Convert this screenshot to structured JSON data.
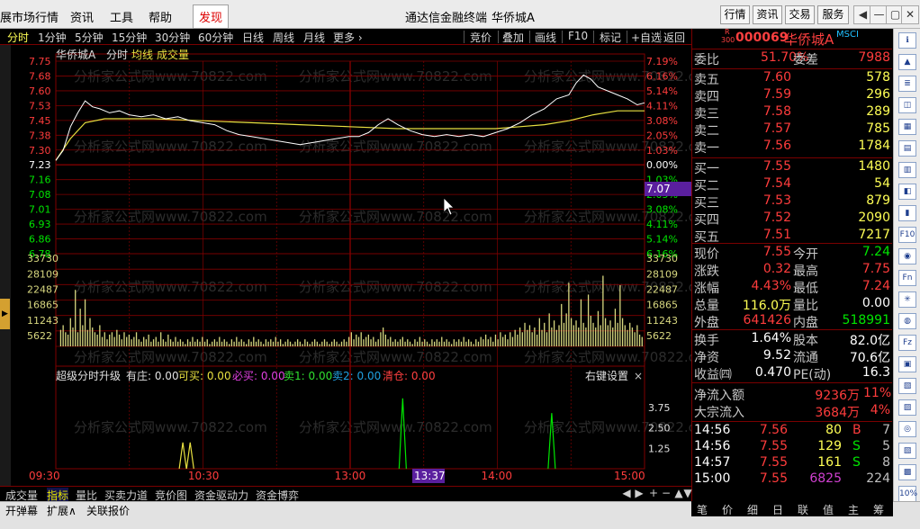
{
  "menu": {
    "items": [
      "展市场行情",
      "资讯",
      "工具",
      "帮助",
      "发现"
    ],
    "app_title": "通达信金融终端",
    "stock_title": "华侨城A",
    "right_buttons": [
      "行情",
      "资讯",
      "交易",
      "服务"
    ],
    "window_controls": [
      "◀",
      "—",
      "▢",
      "✕"
    ]
  },
  "period_bar": {
    "left": [
      "分时",
      "1分钟",
      "5分钟",
      "15分钟",
      "30分钟",
      "60分钟",
      "日线",
      "周线",
      "月线",
      "更多 ›"
    ],
    "right": [
      "竞价",
      "叠加",
      "画线",
      "F10",
      "标记",
      "+自选",
      "返回"
    ]
  },
  "chart_header": {
    "name": "华侨城A",
    "mode": "分时",
    "avg_label": "均线",
    "vol_label": "成交量"
  },
  "cursor_price_label": "7.07",
  "cursor_time_label": "13:37",
  "watermark": "分析家公式网www.70822.com",
  "indicator_header": {
    "title": "超级分时升级",
    "you_zhu": "有庄: 0.00",
    "ke_mai": "可买: 0.00",
    "bi_mai": "必买: 0.00",
    "mai1": "卖1: 0.00",
    "mai2": "卖2: 0.00",
    "qing_cang": "清仓: 0.00",
    "settings": "右键设置",
    "close": "×"
  },
  "indicator_ticks": [
    "3.75",
    "2.50",
    "1.25"
  ],
  "colors": {
    "up": "#ff3c3c",
    "down": "#00e600",
    "grid": "#800000",
    "price_line": "#ffffff",
    "avg_line": "#e8e040",
    "volume": "#d8d880"
  },
  "chart_data": {
    "type": "line",
    "x_labels": [
      "09:30",
      "10:30",
      "13:00",
      "14:00",
      "15:00"
    ],
    "price_ticks": [
      "7.75",
      "7.68",
      "7.60",
      "7.53",
      "7.45",
      "7.38",
      "7.30",
      "7.23",
      "7.16",
      "7.08",
      "7.01",
      "6.93",
      "6.86",
      "6.78"
    ],
    "pct_ticks": [
      "7.19%",
      "6.16%",
      "5.14%",
      "4.11%",
      "3.08%",
      "2.05%",
      "1.03%",
      "0.00%",
      "1.03%",
      "2.05%",
      "3.08%",
      "4.11%",
      "5.14%",
      "6.16%"
    ],
    "ylim": [
      6.78,
      7.75
    ],
    "prev_close": 7.24,
    "price_series": [
      [
        0,
        7.25
      ],
      [
        3,
        7.3
      ],
      [
        6,
        7.42
      ],
      [
        9,
        7.49
      ],
      [
        12,
        7.55
      ],
      [
        15,
        7.52
      ],
      [
        18,
        7.51
      ],
      [
        22,
        7.49
      ],
      [
        26,
        7.5
      ],
      [
        30,
        7.48
      ],
      [
        35,
        7.47
      ],
      [
        40,
        7.48
      ],
      [
        45,
        7.46
      ],
      [
        50,
        7.47
      ],
      [
        55,
        7.45
      ],
      [
        60,
        7.44
      ],
      [
        65,
        7.43
      ],
      [
        70,
        7.4
      ],
      [
        75,
        7.38
      ],
      [
        80,
        7.37
      ],
      [
        85,
        7.36
      ],
      [
        90,
        7.35
      ],
      [
        95,
        7.34
      ],
      [
        100,
        7.33
      ],
      [
        105,
        7.34
      ],
      [
        110,
        7.35
      ],
      [
        115,
        7.36
      ],
      [
        120,
        7.37
      ],
      [
        124,
        7.37
      ],
      [
        128,
        7.39
      ],
      [
        132,
        7.43
      ],
      [
        136,
        7.46
      ],
      [
        140,
        7.43
      ],
      [
        145,
        7.4
      ],
      [
        150,
        7.38
      ],
      [
        155,
        7.37
      ],
      [
        160,
        7.38
      ],
      [
        165,
        7.37
      ],
      [
        170,
        7.38
      ],
      [
        175,
        7.37
      ],
      [
        180,
        7.39
      ],
      [
        185,
        7.41
      ],
      [
        190,
        7.44
      ],
      [
        195,
        7.48
      ],
      [
        200,
        7.51
      ],
      [
        205,
        7.56
      ],
      [
        210,
        7.58
      ],
      [
        213,
        7.64
      ],
      [
        216,
        7.68
      ],
      [
        219,
        7.66
      ],
      [
        222,
        7.62
      ],
      [
        226,
        7.6
      ],
      [
        230,
        7.58
      ],
      [
        234,
        7.56
      ],
      [
        238,
        7.53
      ],
      [
        241,
        7.54
      ]
    ],
    "avg_series": [
      [
        0,
        7.25
      ],
      [
        6,
        7.36
      ],
      [
        12,
        7.44
      ],
      [
        20,
        7.46
      ],
      [
        40,
        7.46
      ],
      [
        60,
        7.45
      ],
      [
        80,
        7.44
      ],
      [
        100,
        7.43
      ],
      [
        120,
        7.42
      ],
      [
        140,
        7.41
      ],
      [
        160,
        7.41
      ],
      [
        180,
        7.41
      ],
      [
        190,
        7.42
      ],
      [
        200,
        7.43
      ],
      [
        210,
        7.45
      ],
      [
        220,
        7.48
      ],
      [
        230,
        7.5
      ],
      [
        241,
        7.5
      ]
    ],
    "volume_ticks": [
      "33730",
      "28109",
      "22487",
      "16865",
      "11243",
      "5622"
    ],
    "volume_ylim": [
      0,
      39352
    ],
    "volume_series": [
      [
        2,
        7000
      ],
      [
        3,
        9000
      ],
      [
        4,
        6000
      ],
      [
        5,
        5000
      ],
      [
        6,
        12000
      ],
      [
        7,
        8000
      ],
      [
        8,
        24000
      ],
      [
        9,
        6000
      ],
      [
        10,
        16000
      ],
      [
        11,
        9000
      ],
      [
        12,
        20000
      ],
      [
        13,
        7000
      ],
      [
        14,
        12000
      ],
      [
        15,
        8000
      ],
      [
        16,
        6000
      ],
      [
        17,
        5000
      ],
      [
        18,
        9000
      ],
      [
        19,
        4000
      ],
      [
        20,
        6000
      ],
      [
        21,
        3000
      ],
      [
        22,
        5000
      ],
      [
        23,
        6000
      ],
      [
        24,
        4000
      ],
      [
        25,
        7000
      ],
      [
        26,
        5000
      ],
      [
        27,
        3000
      ],
      [
        28,
        6000
      ],
      [
        29,
        4000
      ],
      [
        30,
        5000
      ],
      [
        31,
        3000
      ],
      [
        32,
        4000
      ],
      [
        33,
        6000
      ],
      [
        34,
        3000
      ],
      [
        35,
        2000
      ],
      [
        36,
        4000
      ],
      [
        37,
        3000
      ],
      [
        38,
        5000
      ],
      [
        39,
        2000
      ],
      [
        40,
        3000
      ],
      [
        41,
        4000
      ],
      [
        42,
        2000
      ],
      [
        43,
        6000
      ],
      [
        44,
        3000
      ],
      [
        45,
        2000
      ],
      [
        46,
        5000
      ],
      [
        47,
        3000
      ],
      [
        48,
        2000
      ],
      [
        49,
        4000
      ],
      [
        50,
        2000
      ],
      [
        51,
        3000
      ],
      [
        52,
        2000
      ],
      [
        53,
        1000
      ],
      [
        54,
        3000
      ],
      [
        55,
        2000
      ],
      [
        56,
        4000
      ],
      [
        57,
        2000
      ],
      [
        58,
        3000
      ],
      [
        59,
        2000
      ],
      [
        60,
        4000
      ],
      [
        61,
        2000
      ],
      [
        62,
        3000
      ],
      [
        63,
        1000
      ],
      [
        64,
        2000
      ],
      [
        65,
        3000
      ],
      [
        66,
        2000
      ],
      [
        67,
        4000
      ],
      [
        68,
        2000
      ],
      [
        69,
        3000
      ],
      [
        70,
        2000
      ],
      [
        71,
        1000
      ],
      [
        72,
        3000
      ],
      [
        73,
        2000
      ],
      [
        74,
        4000
      ],
      [
        75,
        2000
      ],
      [
        76,
        3000
      ],
      [
        77,
        2000
      ],
      [
        78,
        1000
      ],
      [
        79,
        3000
      ],
      [
        80,
        2000
      ],
      [
        81,
        4000
      ],
      [
        82,
        2000
      ],
      [
        83,
        3000
      ],
      [
        84,
        2000
      ],
      [
        85,
        1000
      ],
      [
        86,
        3000
      ],
      [
        87,
        2000
      ],
      [
        88,
        3000
      ],
      [
        89,
        2000
      ],
      [
        90,
        4000
      ],
      [
        91,
        2000
      ],
      [
        92,
        3000
      ],
      [
        93,
        1000
      ],
      [
        94,
        2000
      ],
      [
        95,
        3000
      ],
      [
        96,
        2000
      ],
      [
        97,
        1000
      ],
      [
        98,
        2000
      ],
      [
        99,
        3000
      ],
      [
        100,
        2000
      ],
      [
        101,
        1000
      ],
      [
        102,
        3000
      ],
      [
        103,
        2000
      ],
      [
        104,
        1000
      ],
      [
        105,
        2000
      ],
      [
        106,
        3000
      ],
      [
        107,
        2000
      ],
      [
        108,
        1000
      ],
      [
        109,
        2000
      ],
      [
        110,
        3000
      ],
      [
        111,
        2000
      ],
      [
        112,
        1000
      ],
      [
        113,
        2000
      ],
      [
        114,
        3000
      ],
      [
        115,
        2000
      ],
      [
        116,
        1000
      ],
      [
        117,
        2000
      ],
      [
        118,
        3000
      ],
      [
        119,
        2000
      ],
      [
        120,
        4000
      ],
      [
        121,
        6000
      ],
      [
        122,
        3000
      ],
      [
        123,
        5000
      ],
      [
        124,
        4000
      ],
      [
        125,
        6000
      ],
      [
        126,
        3000
      ],
      [
        127,
        4000
      ],
      [
        128,
        5000
      ],
      [
        129,
        3000
      ],
      [
        130,
        4000
      ],
      [
        131,
        2000
      ],
      [
        132,
        3000
      ],
      [
        133,
        6000
      ],
      [
        134,
        8000
      ],
      [
        135,
        5000
      ],
      [
        136,
        3000
      ],
      [
        137,
        4000
      ],
      [
        138,
        2000
      ],
      [
        139,
        3000
      ],
      [
        140,
        2000
      ],
      [
        141,
        3000
      ],
      [
        142,
        4000
      ],
      [
        143,
        2000
      ],
      [
        144,
        3000
      ],
      [
        145,
        2000
      ],
      [
        146,
        1000
      ],
      [
        147,
        3000
      ],
      [
        148,
        2000
      ],
      [
        149,
        4000
      ],
      [
        150,
        2000
      ],
      [
        151,
        3000
      ],
      [
        152,
        2000
      ],
      [
        153,
        1000
      ],
      [
        154,
        3000
      ],
      [
        155,
        2000
      ],
      [
        156,
        3000
      ],
      [
        157,
        2000
      ],
      [
        158,
        4000
      ],
      [
        159,
        2000
      ],
      [
        160,
        3000
      ],
      [
        161,
        2000
      ],
      [
        162,
        1000
      ],
      [
        163,
        3000
      ],
      [
        164,
        2000
      ],
      [
        165,
        3000
      ],
      [
        166,
        2000
      ],
      [
        167,
        4000
      ],
      [
        168,
        2000
      ],
      [
        169,
        3000
      ],
      [
        170,
        2000
      ],
      [
        171,
        1000
      ],
      [
        172,
        3000
      ],
      [
        173,
        2000
      ],
      [
        174,
        4000
      ],
      [
        175,
        3000
      ],
      [
        176,
        5000
      ],
      [
        177,
        3000
      ],
      [
        178,
        4000
      ],
      [
        179,
        2000
      ],
      [
        180,
        5000
      ],
      [
        181,
        3000
      ],
      [
        182,
        6000
      ],
      [
        183,
        4000
      ],
      [
        184,
        5000
      ],
      [
        185,
        3000
      ],
      [
        186,
        6000
      ],
      [
        187,
        4000
      ],
      [
        188,
        7000
      ],
      [
        189,
        5000
      ],
      [
        190,
        8000
      ],
      [
        191,
        6000
      ],
      [
        192,
        10000
      ],
      [
        193,
        7000
      ],
      [
        194,
        9000
      ],
      [
        195,
        6000
      ],
      [
        196,
        8000
      ],
      [
        197,
        5000
      ],
      [
        198,
        12000
      ],
      [
        199,
        7000
      ],
      [
        200,
        10000
      ],
      [
        201,
        6000
      ],
      [
        202,
        14000
      ],
      [
        203,
        8000
      ],
      [
        204,
        11000
      ],
      [
        205,
        7000
      ],
      [
        206,
        9000
      ],
      [
        207,
        18000
      ],
      [
        208,
        10000
      ],
      [
        209,
        14000
      ],
      [
        210,
        27000
      ],
      [
        211,
        12000
      ],
      [
        212,
        9000
      ],
      [
        213,
        11000
      ],
      [
        214,
        8000
      ],
      [
        215,
        20000
      ],
      [
        216,
        10000
      ],
      [
        217,
        8000
      ],
      [
        218,
        22000
      ],
      [
        219,
        13000
      ],
      [
        220,
        10000
      ],
      [
        221,
        8000
      ],
      [
        222,
        15000
      ],
      [
        223,
        9000
      ],
      [
        224,
        30000
      ],
      [
        225,
        12000
      ],
      [
        226,
        9000
      ],
      [
        227,
        11000
      ],
      [
        228,
        8000
      ],
      [
        229,
        16000
      ],
      [
        230,
        10000
      ],
      [
        231,
        26000
      ],
      [
        232,
        12000
      ],
      [
        233,
        9000
      ],
      [
        234,
        7000
      ],
      [
        235,
        10000
      ],
      [
        236,
        8000
      ],
      [
        237,
        6000
      ],
      [
        238,
        9000
      ],
      [
        239,
        5000
      ],
      [
        240,
        4000
      ]
    ],
    "indicator_ylim": [
      0,
      5.0
    ],
    "indicator_spikes": [
      {
        "t": 52,
        "v": 1.6,
        "color": "#e8e040"
      },
      {
        "t": 55,
        "v": 1.6,
        "color": "#e8e040"
      },
      {
        "t": 142,
        "v": 4.3,
        "color": "#00e600"
      },
      {
        "t": 203,
        "v": 3.4,
        "color": "#00e600"
      }
    ]
  },
  "right_panel": {
    "code": "000069",
    "name": "华侨城A",
    "tag": "MSCI",
    "r_badge": "R",
    "r_sub": "300",
    "weibi": {
      "label": "委比",
      "value": "51.70%",
      "label2": "委差",
      "value2": "7988"
    },
    "asks": [
      {
        "label": "卖五",
        "price": "7.60",
        "vol": "578"
      },
      {
        "label": "卖四",
        "price": "7.59",
        "vol": "296"
      },
      {
        "label": "卖三",
        "price": "7.58",
        "vol": "289"
      },
      {
        "label": "卖二",
        "price": "7.57",
        "vol": "785"
      },
      {
        "label": "卖一",
        "price": "7.56",
        "vol": "1784"
      }
    ],
    "bids": [
      {
        "label": "买一",
        "price": "7.55",
        "vol": "1480"
      },
      {
        "label": "买二",
        "price": "7.54",
        "vol": "54"
      },
      {
        "label": "买三",
        "price": "7.53",
        "vol": "879"
      },
      {
        "label": "买四",
        "price": "7.52",
        "vol": "2090"
      },
      {
        "label": "买五",
        "price": "7.51",
        "vol": "7217"
      }
    ],
    "stats1": [
      {
        "l1": "现价",
        "v1": "7.55",
        "c1": "#ff3c3c",
        "l2": "今开",
        "v2": "7.24",
        "c2": "#00e600"
      },
      {
        "l1": "涨跌",
        "v1": "0.32",
        "c1": "#ff3c3c",
        "l2": "最高",
        "v2": "7.75",
        "c2": "#ff3c3c"
      },
      {
        "l1": "涨幅",
        "v1": "4.43%",
        "c1": "#ff3c3c",
        "l2": "最低",
        "v2": "7.24",
        "c2": "#ff3c3c"
      },
      {
        "l1": "总量",
        "v1": "116.0万",
        "c1": "#ffff55",
        "l2": "量比",
        "v2": "0.00",
        "c2": "#ffffff"
      },
      {
        "l1": "外盘",
        "v1": "641426",
        "c1": "#ff3c3c",
        "l2": "内盘",
        "v2": "518991",
        "c2": "#00e600"
      }
    ],
    "stats2": [
      {
        "l1": "换手",
        "v1": "1.64%",
        "l2": "股本",
        "v2": "82.0亿"
      },
      {
        "l1": "净资",
        "v1": "9.52",
        "l2": "流通",
        "v2": "70.6亿"
      },
      {
        "l1": "收益㈣",
        "v1": "0.470",
        "l2": "PE(动)",
        "v2": "16.3"
      }
    ],
    "flows": [
      {
        "label": "净流入额",
        "value": "9236万",
        "pct": "11%"
      },
      {
        "label": "大宗流入",
        "value": "3684万",
        "pct": "4%"
      }
    ],
    "ticks": [
      {
        "time": "14:56",
        "price": "7.56",
        "vol": "80",
        "vc": "#ffff55",
        "side": "B",
        "sc": "#ff3c3c",
        "n": "7"
      },
      {
        "time": "14:56",
        "price": "7.55",
        "vol": "129",
        "vc": "#ffff55",
        "side": "S",
        "sc": "#00e600",
        "n": "5"
      },
      {
        "time": "14:57",
        "price": "7.55",
        "vol": "161",
        "vc": "#ffff55",
        "side": "S",
        "sc": "#00e600",
        "n": "8"
      },
      {
        "time": "15:00",
        "price": "7.55",
        "vol": "6825",
        "vc": "#d040d0",
        "side": "",
        "sc": "#00e600",
        "n": "224"
      }
    ],
    "tabs": [
      "笔",
      "价",
      "细",
      "日",
      "联",
      "值",
      "主",
      "筹"
    ]
  },
  "bottom_tabs": {
    "row1": [
      "成交量",
      "指标",
      "量比",
      "买卖力道",
      "竞价图",
      "资金驱动力",
      "资金博弈"
    ],
    "row2": [
      "开弹幕",
      "扩展∧",
      "关联报价"
    ],
    "nav": [
      "◀",
      "▶",
      "+",
      "−",
      "▲",
      "▼"
    ]
  },
  "side_icons": [
    "ℹ",
    "▲",
    "≣",
    "◫",
    "▦",
    "▤",
    "▥",
    "◧",
    "▮",
    "F10",
    "◉",
    "Fn",
    "✳",
    "◍",
    "Fz",
    "▣",
    "▧",
    "▨",
    "◎",
    "▧",
    "▩",
    "10%"
  ]
}
